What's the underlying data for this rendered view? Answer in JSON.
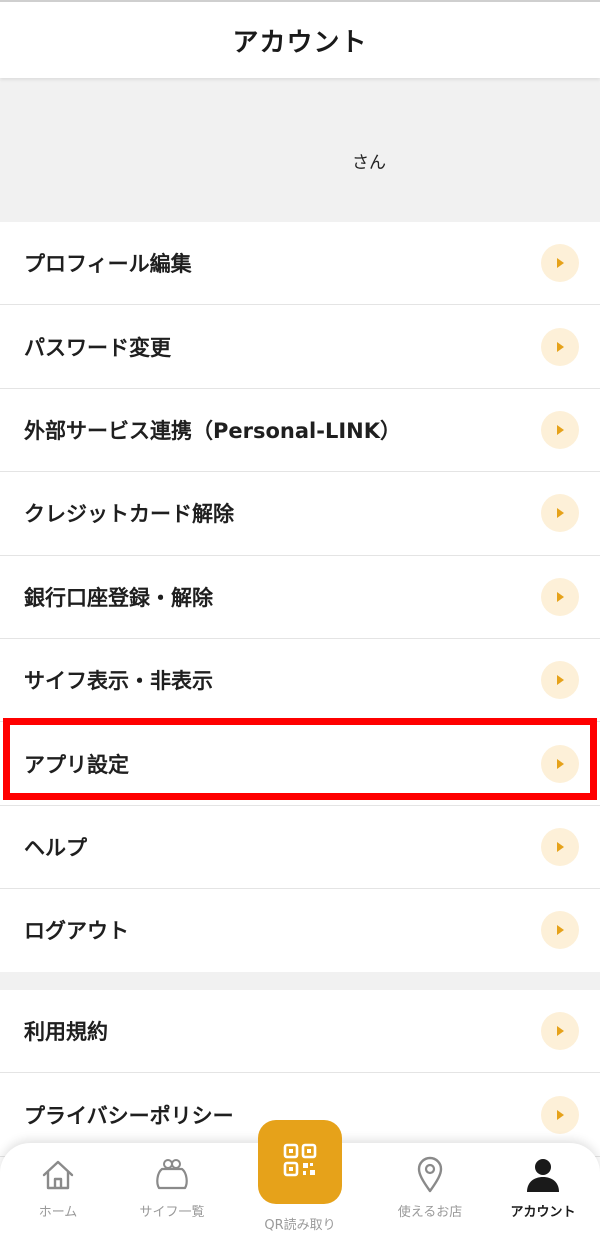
{
  "header": {
    "title": "アカウント"
  },
  "profile": {
    "name_suffix": "さん"
  },
  "menu_main": [
    {
      "label": "プロフィール編集"
    },
    {
      "label": "パスワード変更"
    },
    {
      "label": "外部サービス連携（Personal-LINK）"
    },
    {
      "label": "クレジットカード解除"
    },
    {
      "label": "銀行口座登録・解除"
    },
    {
      "label": "サイフ表示・非表示"
    },
    {
      "label": "アプリ設定",
      "highlighted": true
    },
    {
      "label": "ヘルプ"
    },
    {
      "label": "ログアウト"
    }
  ],
  "menu_legal": [
    {
      "label": "利用規約"
    },
    {
      "label": "プライバシーポリシー"
    }
  ],
  "bottom_nav": {
    "items": [
      {
        "label": "ホーム",
        "icon": "home-icon"
      },
      {
        "label": "サイフ一覧",
        "icon": "purse-icon"
      },
      {
        "label": "QR読み取り",
        "icon": "qr-icon"
      },
      {
        "label": "使えるお店",
        "icon": "location-pin-icon"
      },
      {
        "label": "アカウント",
        "icon": "person-icon",
        "active": true
      }
    ]
  },
  "colors": {
    "accent": "#e6a21a",
    "chevron_bg": "#fdf0d8",
    "highlight": "#ff0000",
    "band_bg": "#f1f1f1"
  }
}
